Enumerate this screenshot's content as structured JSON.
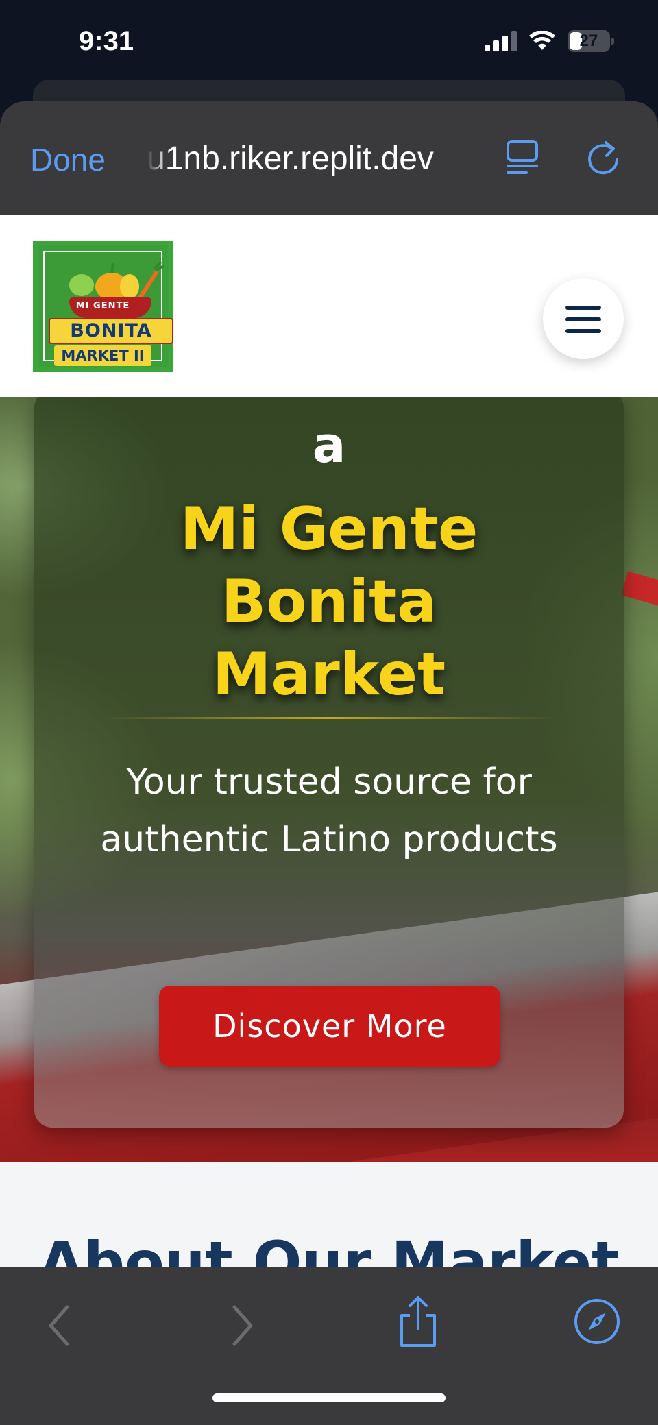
{
  "status_bar": {
    "time": "9:31",
    "battery": "27",
    "icons": [
      "signal-icon",
      "wifi-icon",
      "battery-icon"
    ]
  },
  "browser": {
    "done_label": "Done",
    "url": "u1nb.riker.replit.dev",
    "accent_color": "#5a9cf0",
    "toolbar_icons": [
      "reader-icon",
      "reload-icon"
    ],
    "bottom_icons": [
      "back-icon",
      "forward-icon",
      "share-icon",
      "compass-icon"
    ]
  },
  "site": {
    "logo": {
      "mi_gente": "MI GENTE",
      "bonita": "BONITA",
      "market": "MARKET II"
    },
    "menu_icon": "hamburger-icon",
    "hero": {
      "overline": "a",
      "title": "Mi Gente Bonita Market",
      "subtitle": "Your trusted source for authentic Latino products",
      "button_label": "Discover More",
      "title_color": "#f7d41a",
      "button_color": "#c91818"
    },
    "about": {
      "heading": "About Our Market",
      "heading_color": "#17375e"
    }
  }
}
